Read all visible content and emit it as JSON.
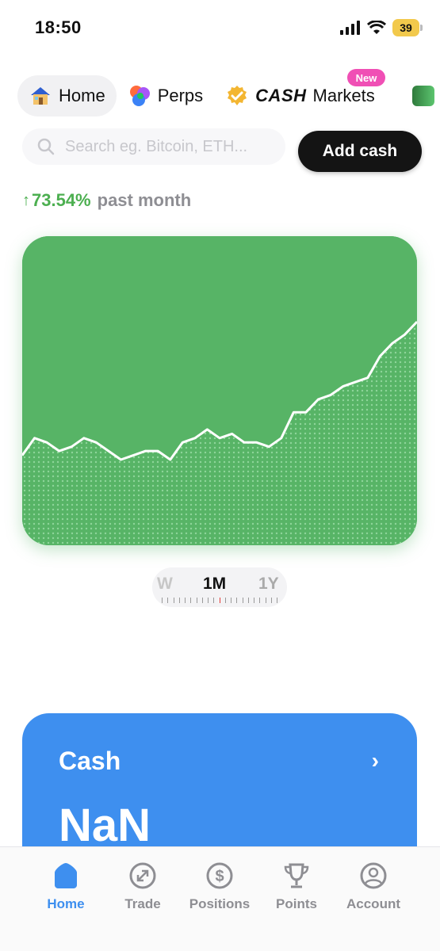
{
  "status_bar": {
    "time": "18:50",
    "battery": "39"
  },
  "top_tabs": [
    {
      "label": "Home",
      "icon": "house-icon",
      "active": true
    },
    {
      "label": "Perps",
      "icon": "perps-swirl-icon",
      "active": false
    },
    {
      "logo": "CASH",
      "label": "Markets",
      "icon": "verified-badge-icon",
      "badge": "New",
      "active": false
    }
  ],
  "search": {
    "placeholder": "Search eg. Bitcoin, ETH..."
  },
  "add_cash": {
    "label": "Add cash"
  },
  "performance": {
    "change": "73.54%",
    "period": "past month",
    "color": "#4caf50"
  },
  "chart_data": {
    "type": "area",
    "title": "",
    "xlabel": "",
    "ylabel": "",
    "color": "#57b466",
    "series": [
      {
        "values": [
          100,
          104,
          103,
          101,
          102,
          104,
          103,
          101,
          99,
          100,
          101,
          101,
          99,
          103,
          104,
          106,
          104,
          105,
          103,
          103,
          102,
          104,
          110,
          110,
          113,
          114,
          116,
          117,
          118,
          123,
          126,
          128,
          131
        ]
      }
    ]
  },
  "range_selector": {
    "options": [
      "W",
      "1M",
      "1Y"
    ],
    "selected": "1M"
  },
  "cash_card": {
    "title": "Cash",
    "value": "NaN"
  },
  "bottom_nav": [
    {
      "label": "Home",
      "icon": "home-icon",
      "active": true
    },
    {
      "label": "Trade",
      "icon": "trade-icon",
      "active": false
    },
    {
      "label": "Positions",
      "icon": "dollar-circle-icon",
      "active": false
    },
    {
      "label": "Points",
      "icon": "trophy-icon",
      "active": false
    },
    {
      "label": "Account",
      "icon": "user-circle-icon",
      "active": false
    }
  ]
}
